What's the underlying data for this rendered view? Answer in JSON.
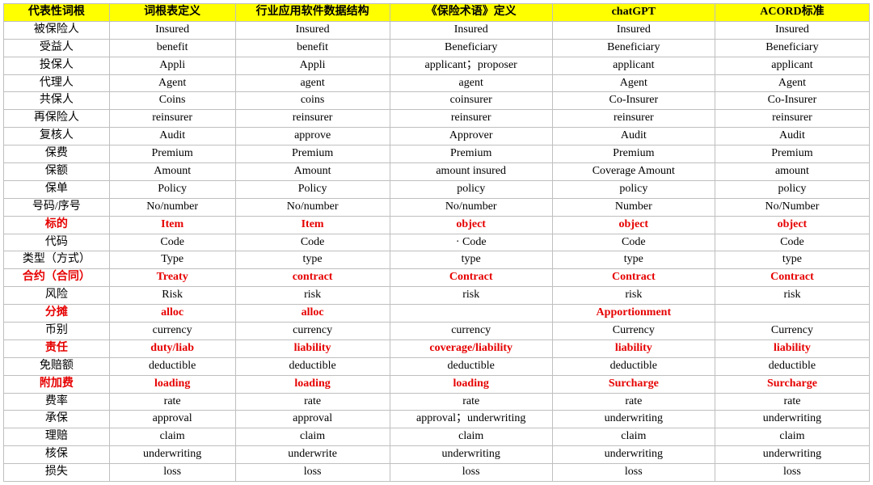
{
  "headers": [
    "代表性词根",
    "词根表定义",
    "行业应用软件数据结构",
    "《保险术语》定义",
    "chatGPT",
    "ACORD标准"
  ],
  "chart_data": {
    "type": "table",
    "columns": [
      "代表性词根",
      "词根表定义",
      "行业应用软件数据结构",
      "《保险术语》定义",
      "chatGPT",
      "ACORD标准"
    ],
    "rows": [
      {
        "hl": false,
        "cells": [
          "被保险人",
          "Insured",
          "Insured",
          "Insured",
          "Insured",
          "Insured"
        ]
      },
      {
        "hl": false,
        "cells": [
          "受益人",
          "benefit",
          "benefit",
          "Beneficiary",
          "Beneficiary",
          "Beneficiary"
        ]
      },
      {
        "hl": false,
        "cells": [
          "投保人",
          "Appli",
          "Appli",
          "applicant；proposer",
          "applicant",
          "applicant"
        ]
      },
      {
        "hl": false,
        "cells": [
          "代理人",
          "Agent",
          "agent",
          "agent",
          "Agent",
          "Agent"
        ]
      },
      {
        "hl": false,
        "cells": [
          "共保人",
          "Coins",
          "coins",
          "coinsurer",
          "Co-Insurer",
          "Co-Insurer"
        ]
      },
      {
        "hl": false,
        "cells": [
          "再保险人",
          "reinsurer",
          "reinsurer",
          "reinsurer",
          "reinsurer",
          "reinsurer"
        ]
      },
      {
        "hl": false,
        "cells": [
          "复核人",
          "Audit",
          "approve",
          "Approver",
          "Audit",
          "Audit"
        ]
      },
      {
        "hl": false,
        "cells": [
          "保费",
          "Premium",
          "Premium",
          "Premium",
          "Premium",
          "Premium"
        ]
      },
      {
        "hl": false,
        "cells": [
          "保额",
          "Amount",
          "Amount",
          "amount insured",
          "Coverage Amount",
          "amount"
        ]
      },
      {
        "hl": false,
        "cells": [
          "保单",
          "Policy",
          "Policy",
          "policy",
          "policy",
          "policy"
        ]
      },
      {
        "hl": false,
        "cells": [
          "号码/序号",
          "No/number",
          "No/number",
          "No/number",
          "Number",
          "No/Number"
        ]
      },
      {
        "hl": true,
        "cells": [
          "标的",
          "Item",
          "Item",
          "object",
          "object",
          "object"
        ]
      },
      {
        "hl": false,
        "cells": [
          "代码",
          "Code",
          "Code",
          "· Code",
          "Code",
          "Code"
        ]
      },
      {
        "hl": false,
        "cells": [
          "类型（方式）",
          "Type",
          "type",
          "type",
          "type",
          "type"
        ]
      },
      {
        "hl": true,
        "cells": [
          "合约（合同）",
          "Treaty",
          "contract",
          "Contract",
          "Contract",
          "Contract"
        ]
      },
      {
        "hl": false,
        "cells": [
          "风险",
          "Risk",
          "risk",
          "risk",
          "risk",
          "risk"
        ]
      },
      {
        "hl": true,
        "cells": [
          "分摊",
          "alloc",
          "alloc",
          "",
          "Apportionment",
          ""
        ]
      },
      {
        "hl": false,
        "cells": [
          "币别",
          "currency",
          "currency",
          "currency",
          "Currency",
          "Currency"
        ]
      },
      {
        "hl": true,
        "cells": [
          "责任",
          "duty/liab",
          "liability",
          "coverage/liability",
          "liability",
          "liability"
        ]
      },
      {
        "hl": false,
        "cells": [
          "免赔额",
          "deductible",
          "deductible",
          "deductible",
          "deductible",
          "deductible"
        ]
      },
      {
        "hl": true,
        "cells": [
          "附加费",
          "loading",
          "loading",
          "loading",
          "Surcharge",
          "Surcharge"
        ]
      },
      {
        "hl": false,
        "cells": [
          "费率",
          "rate",
          "rate",
          "rate",
          "rate",
          "rate"
        ]
      },
      {
        "hl": false,
        "cells": [
          "承保",
          "approval",
          "approval",
          "approval；underwriting",
          "underwriting",
          "underwriting"
        ]
      },
      {
        "hl": false,
        "cells": [
          "理赔",
          "claim",
          "claim",
          "claim",
          "claim",
          "claim"
        ]
      },
      {
        "hl": false,
        "cells": [
          "核保",
          "underwriting",
          "underwrite",
          "underwriting",
          "underwriting",
          "underwriting"
        ]
      },
      {
        "hl": false,
        "cells": [
          "损失",
          "loss",
          "loss",
          "loss",
          "loss",
          "loss"
        ]
      }
    ]
  }
}
